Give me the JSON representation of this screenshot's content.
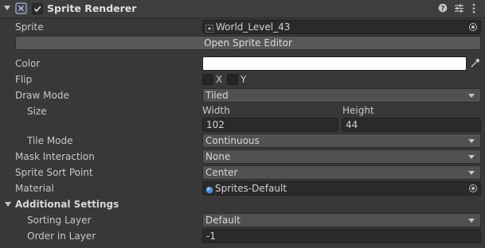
{
  "header": {
    "title": "Sprite Renderer",
    "enabled": true,
    "icons": [
      "foldout-arrow-icon",
      "sprite-renderer-icon",
      "help-icon",
      "presets-icon",
      "kebab-menu-icon"
    ]
  },
  "sprite": {
    "label": "Sprite",
    "value": "World_Level_43",
    "icon": "sprite-asset-icon"
  },
  "open_editor_button": "Open Sprite Editor",
  "color": {
    "label": "Color",
    "value": "#ffffff"
  },
  "flip": {
    "label": "Flip",
    "x_label": "X",
    "y_label": "Y",
    "x_checked": false,
    "y_checked": false
  },
  "draw_mode": {
    "label": "Draw Mode",
    "value": "Tiled"
  },
  "size": {
    "label": "Size",
    "width_label": "Width",
    "height_label": "Height",
    "width_value": "102",
    "height_value": "44"
  },
  "tile_mode": {
    "label": "Tile Mode",
    "value": "Continuous"
  },
  "mask_interaction": {
    "label": "Mask Interaction",
    "value": "None"
  },
  "sprite_sort_point": {
    "label": "Sprite Sort Point",
    "value": "Center"
  },
  "material": {
    "label": "Material",
    "value": "Sprites-Default",
    "icon": "material-icon"
  },
  "additional_settings": {
    "label": "Additional Settings",
    "sorting_layer": {
      "label": "Sorting Layer",
      "value": "Default"
    },
    "order_in_layer": {
      "label": "Order in Layer",
      "value": "-1"
    }
  }
}
